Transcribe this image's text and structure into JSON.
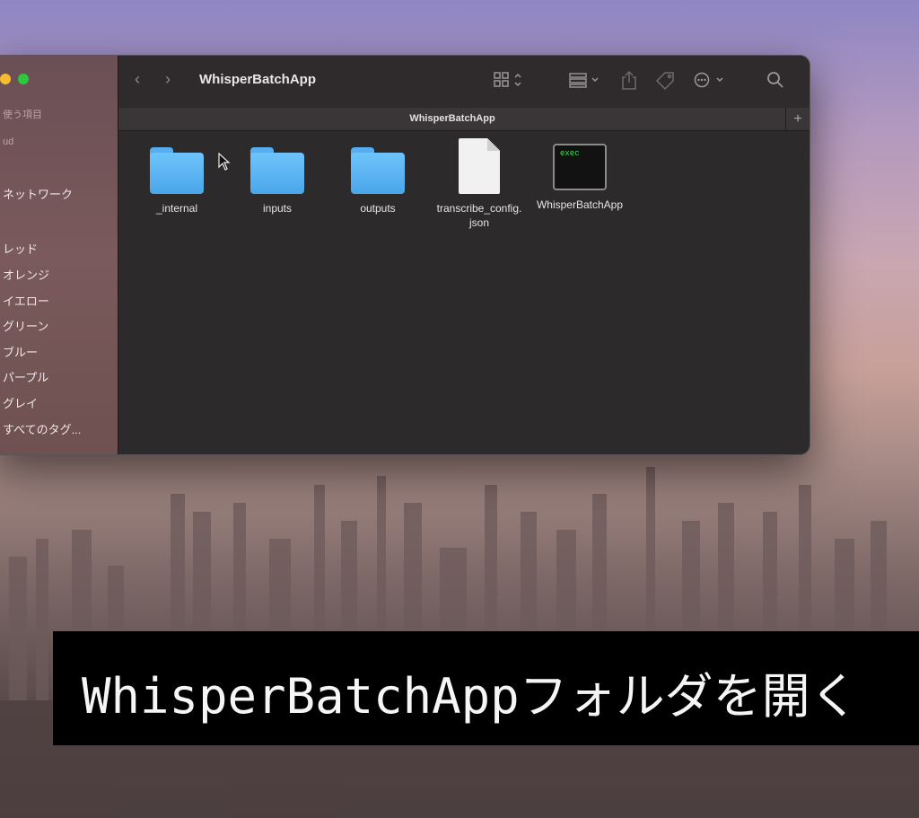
{
  "window": {
    "title": "WhisperBatchApp",
    "tab_title": "WhisperBatchApp",
    "tab_add": "+"
  },
  "sidebar": {
    "section_recent": "使う項目",
    "section_icloud": "ud",
    "network": "ネットワーク",
    "tags": [
      "レッド",
      "オレンジ",
      "イエロー",
      "グリーン",
      "ブルー",
      "パープル",
      "グレイ",
      "すべてのタグ..."
    ]
  },
  "toolbar": {
    "back_icon": "chevron-left-icon",
    "forward_icon": "chevron-right-icon",
    "view_icon": "grid-view-icon",
    "group_icon": "group-icon",
    "share_icon": "share-icon",
    "tag_icon": "tag-icon",
    "more_icon": "ellipsis-circle-icon",
    "search_icon": "search-icon"
  },
  "files": [
    {
      "name": "_internal",
      "kind": "folder"
    },
    {
      "name": "inputs",
      "kind": "folder"
    },
    {
      "name": "outputs",
      "kind": "folder"
    },
    {
      "name": "transcribe_config.\njson",
      "kind": "document"
    },
    {
      "name": "WhisperBatchApp",
      "kind": "executable",
      "badge": "exec"
    }
  ],
  "caption": "WhisperBatchAppフォルダを開く",
  "colors": {
    "folder": "#5bb4f4",
    "caption_bg": "#000000",
    "exec_text": "#3ee052"
  }
}
